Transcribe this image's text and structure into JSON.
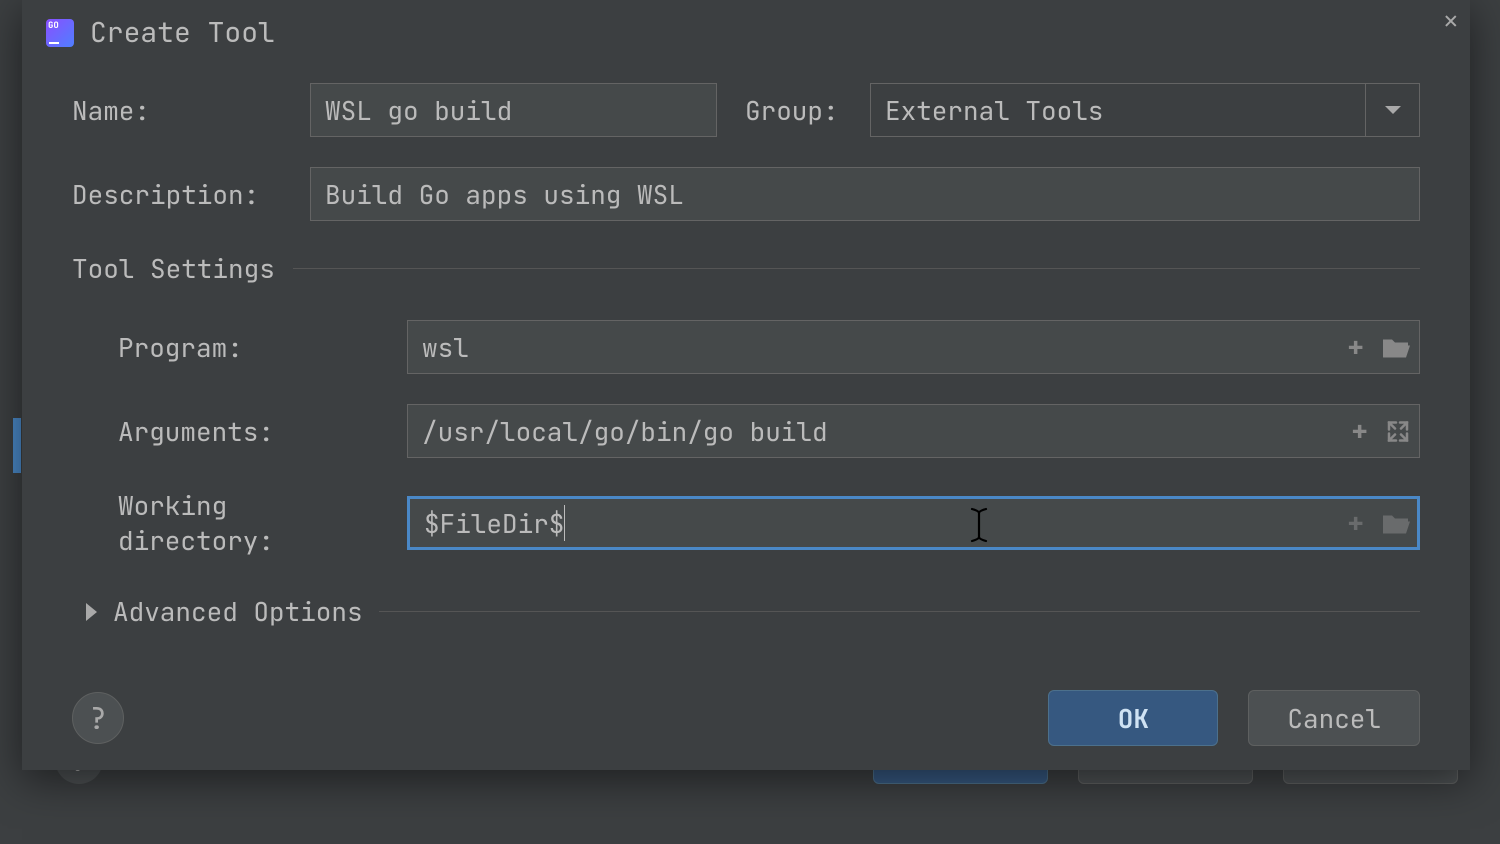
{
  "dialog": {
    "title": "Create Tool",
    "labels": {
      "name": "Name:",
      "group": "Group:",
      "description": "Description:",
      "program": "Program:",
      "arguments": "Arguments:",
      "working_directory": "Working directory:"
    },
    "values": {
      "name": "WSL go build",
      "group": "External Tools",
      "description": "Build Go apps using WSL",
      "program": "wsl",
      "arguments": "/usr/local/go/bin/go build",
      "working_directory": "$FileDir$"
    },
    "sections": {
      "tool_settings": "Tool Settings",
      "advanced_options": "Advanced Options"
    },
    "buttons": {
      "ok": "OK",
      "cancel": "Cancel",
      "help": "?"
    },
    "icons": {
      "close": "✕",
      "plus": "+",
      "folder": "folder-open-icon",
      "expand": "expand-icon",
      "chevron_down": "chevron-down-icon",
      "triangle_right": "triangle-right-icon"
    }
  }
}
